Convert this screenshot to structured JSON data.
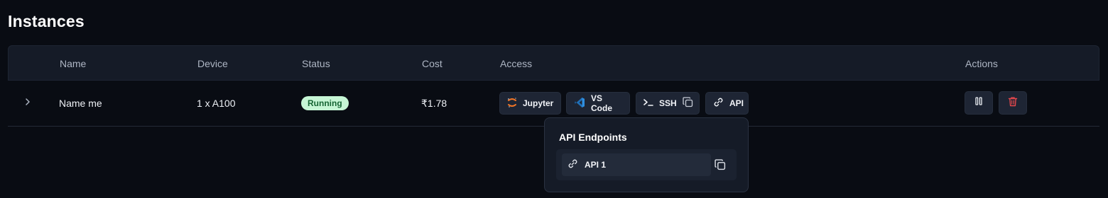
{
  "page": {
    "title": "Instances"
  },
  "table": {
    "headers": {
      "name": "Name",
      "device": "Device",
      "status": "Status",
      "cost": "Cost",
      "access": "Access",
      "actions": "Actions"
    },
    "rows": [
      {
        "name": "Name me",
        "device": "1 x A100",
        "status": "Running",
        "cost": "₹1.78",
        "access": {
          "jupyter": "Jupyter",
          "vscode": "VS Code",
          "ssh": "SSH",
          "api": "API"
        }
      }
    ]
  },
  "popover": {
    "title": "API Endpoints",
    "items": [
      {
        "label": "API 1"
      }
    ]
  },
  "icons": {
    "expand": "chevron-right-icon",
    "jupyter": "jupyter-icon",
    "vscode": "vscode-icon",
    "ssh": "terminal-icon",
    "copy": "copy-icon",
    "api": "link-icon",
    "pause": "pause-icon",
    "delete": "trash-icon"
  },
  "colors": {
    "background": "#090c13",
    "status_badge_bg": "#c6f6d5",
    "status_badge_text": "#166534",
    "delete_icon": "#e5484d",
    "vscode_blue": "#2f8fe0",
    "jupyter_orange": "#f37626"
  }
}
